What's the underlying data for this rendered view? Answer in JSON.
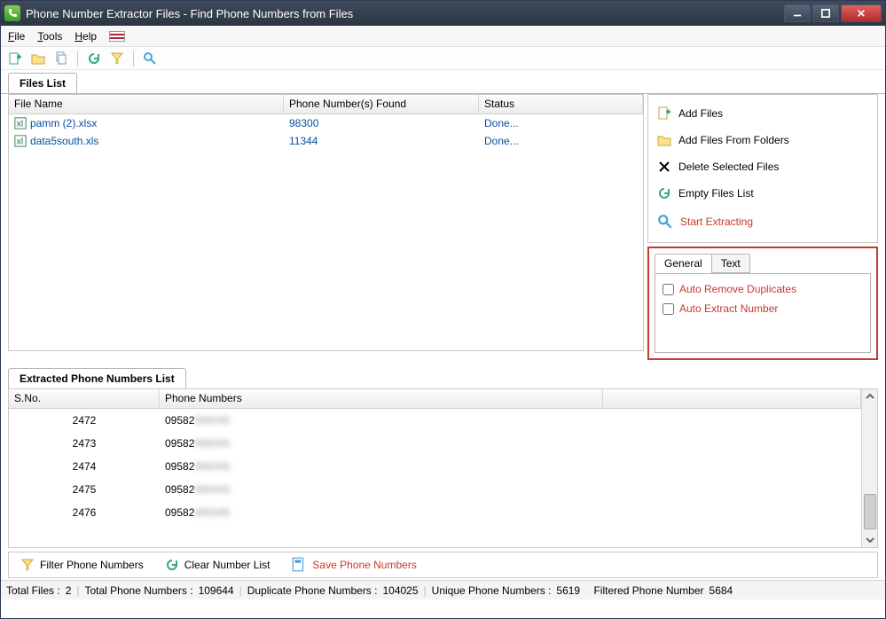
{
  "window": {
    "title": "Phone Number Extractor Files - Find Phone Numbers from Files"
  },
  "menu": {
    "file": "File",
    "tools": "Tools",
    "help": "Help"
  },
  "tabs": {
    "files_list": "Files List",
    "extracted_list": "Extracted Phone Numbers List"
  },
  "files_table": {
    "headers": {
      "name": "File Name",
      "found": "Phone Number(s) Found",
      "status": "Status"
    },
    "rows": [
      {
        "name": "pamm (2).xlsx",
        "found": "98300",
        "status": "Done..."
      },
      {
        "name": "data5south.xls",
        "found": "11344",
        "status": "Done..."
      }
    ]
  },
  "side_actions": {
    "add_files": "Add Files",
    "add_folders": "Add Files From Folders",
    "delete_selected": "Delete Selected Files",
    "empty_list": "Empty Files List",
    "start": "Start Extracting"
  },
  "options": {
    "tab_general": "General",
    "tab_text": "Text",
    "auto_remove_dup": "Auto Remove Duplicates",
    "auto_extract": "Auto Extract Number"
  },
  "extracted_table": {
    "headers": {
      "sno": "S.No.",
      "phone": "Phone Numbers"
    },
    "rows": [
      {
        "sno": "2472",
        "phone_prefix": "09582"
      },
      {
        "sno": "2473",
        "phone_prefix": "09582"
      },
      {
        "sno": "2474",
        "phone_prefix": "09582"
      },
      {
        "sno": "2475",
        "phone_prefix": "09582"
      },
      {
        "sno": "2476",
        "phone_prefix": "09582"
      }
    ]
  },
  "bottom": {
    "filter": "Filter Phone Numbers",
    "clear": "Clear Number List",
    "save": "Save Phone Numbers"
  },
  "status": {
    "total_files_label": "Total Files :",
    "total_files": "2",
    "total_numbers_label": "Total Phone Numbers :",
    "total_numbers": "109644",
    "dup_label": "Duplicate Phone Numbers :",
    "dup": "104025",
    "unique_label": "Unique Phone Numbers :",
    "unique": "5619",
    "filtered_label": "Filtered Phone Number",
    "filtered": "5684"
  }
}
